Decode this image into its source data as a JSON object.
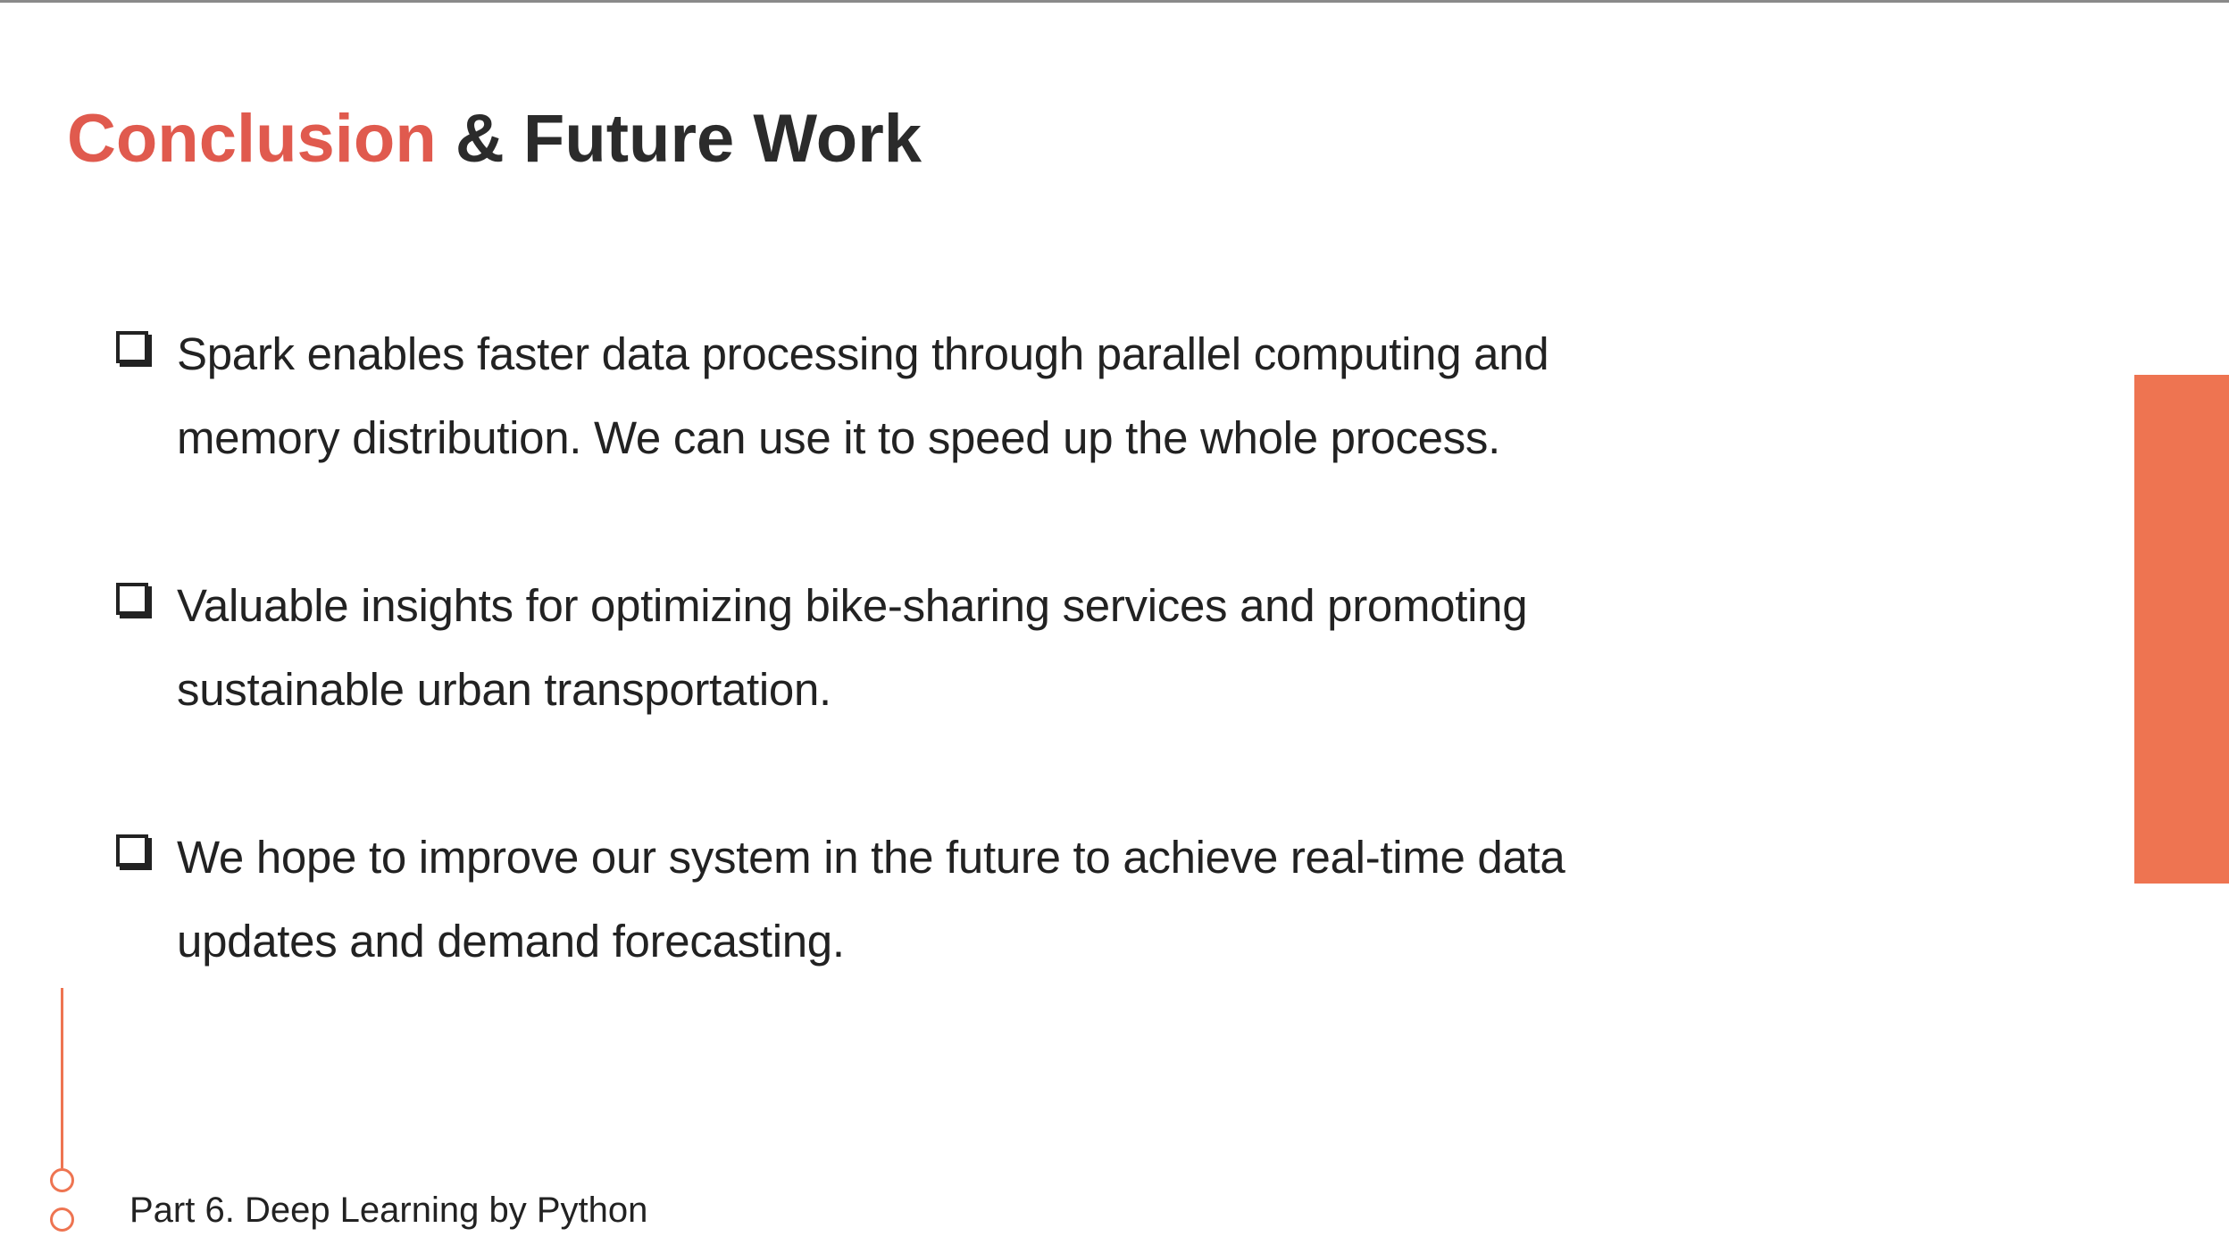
{
  "colors": {
    "accent": "#e05a4e",
    "side_bar": "#ee7451",
    "text": "#222222",
    "title_text": "#2b2b2b"
  },
  "slide": {
    "title": {
      "accent": "Conclusion",
      "rest": " & Future Work"
    },
    "bullets": [
      {
        "icon": "checkbox-icon",
        "text": "Spark enables faster data processing through parallel computing and memory distribution. We can use it to speed up the whole process."
      },
      {
        "icon": "checkbox-icon",
        "text": "Valuable insights for optimizing bike-sharing services and promoting sustainable urban transportation."
      },
      {
        "icon": "checkbox-icon",
        "text": "We hope to improve our system in the future to achieve real-time data updates and demand forecasting."
      }
    ],
    "footer": "Part 6. Deep Learning by Python"
  }
}
